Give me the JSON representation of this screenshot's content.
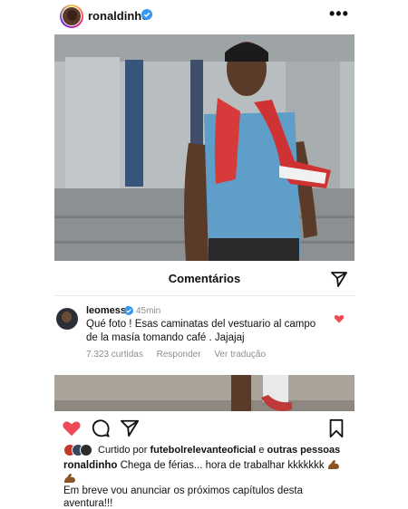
{
  "post": {
    "username": "ronaldinho",
    "more_label": "•••"
  },
  "comments_sheet": {
    "title": "Comentários",
    "comment": {
      "username": "leomessi",
      "time": "45min",
      "text": "Qué foto ! Esas caminatas del vestuario al campo de la masía tomando café . Jajajaj",
      "likes": "7.323 curtidas",
      "reply_label": "Responder",
      "translate_label": "Ver tradução"
    }
  },
  "likes": {
    "prefix": "Curtido por",
    "user": "futebolrelevanteoficial",
    "joiner": "e",
    "others": "outras pessoas"
  },
  "caption": {
    "username": "ronaldinho",
    "text": "Chega de férias... hora de trabalhar kkkkkkk",
    "continuation": "Em breve vou anunciar os próximos capítulos desta aventura!!!"
  },
  "colors": {
    "verified": "#3897f0",
    "heart": "#ed4956",
    "muted": "#8e8e8e"
  },
  "icons": {
    "verified": "verified-badge-icon",
    "more": "more-options-icon",
    "share": "paper-plane-icon",
    "like": "heart-icon",
    "comment": "speech-bubble-icon",
    "save": "bookmark-icon",
    "flex": "flexed-biceps-emoji"
  }
}
